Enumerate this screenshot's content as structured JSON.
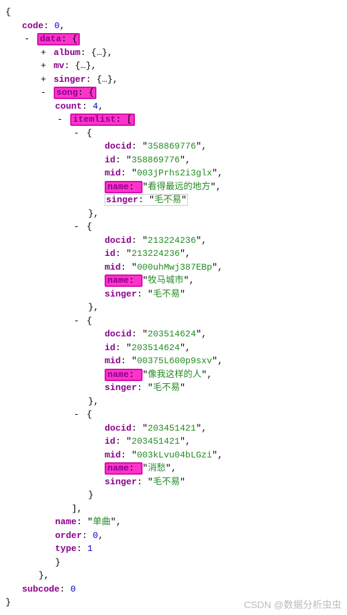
{
  "root": {
    "code_key": "code",
    "code_val": "0",
    "data_key": "data",
    "album_key": "album",
    "mv_key": "mv",
    "singer_key": "singer",
    "song_key": "song",
    "count_key": "count",
    "count_val": "4",
    "itemlist_key": "itemlist",
    "song_name_key": "name",
    "song_name_val": "单曲",
    "order_key": "order",
    "order_val": "0",
    "type_key": "type",
    "type_val": "1",
    "subcode_key": "subcode",
    "subcode_val": "0"
  },
  "items": [
    {
      "docid_key": "docid",
      "docid_val": "358869776",
      "id_key": "id",
      "id_val": "358869776",
      "mid_key": "mid",
      "mid_val": "003jPrhs2i3glx",
      "name_key": "name",
      "name_val": "看得最远的地方",
      "singer_key": "singer",
      "singer_val": "毛不易"
    },
    {
      "docid_key": "docid",
      "docid_val": "213224236",
      "id_key": "id",
      "id_val": "213224236",
      "mid_key": "mid",
      "mid_val": "000uhMwj387EBp",
      "name_key": "name",
      "name_val": "牧马城市",
      "singer_key": "singer",
      "singer_val": "毛不易"
    },
    {
      "docid_key": "docid",
      "docid_val": "203514624",
      "id_key": "id",
      "id_val": "203514624",
      "mid_key": "mid",
      "mid_val": "00375L600p9sxv",
      "name_key": "name",
      "name_val": "像我这样的人",
      "singer_key": "singer",
      "singer_val": "毛不易"
    },
    {
      "docid_key": "docid",
      "docid_val": "203451421",
      "id_key": "id",
      "id_val": "203451421",
      "mid_key": "mid",
      "mid_val": "003kLvu04bLGzi",
      "name_key": "name",
      "name_val": "消愁",
      "singer_key": "singer",
      "singer_val": "毛不易"
    }
  ],
  "watermark": "CSDN @数据分析虫虫"
}
